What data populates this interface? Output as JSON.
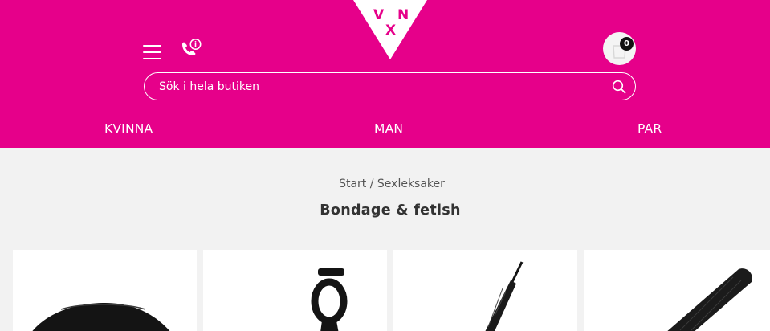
{
  "header": {
    "logo_letters": {
      "v": "V",
      "n": "N",
      "x": "X"
    },
    "cart_count": "0",
    "icons": {
      "menu": "hamburger-icon",
      "phone": "phone-info-icon",
      "cart": "shopping-bag-icon",
      "search": "search-icon"
    }
  },
  "search": {
    "placeholder": "Sök i hela butiken"
  },
  "nav": {
    "kvinna": "KVINNA",
    "man": "MAN",
    "par": "PAR"
  },
  "breadcrumb": {
    "start": "Start",
    "separator": " / ",
    "current": "Sexleksaker"
  },
  "page_title": "Bondage & fetish",
  "colors": {
    "brand": "#e6008a",
    "background": "#f2f2f2",
    "card": "#ffffff"
  }
}
